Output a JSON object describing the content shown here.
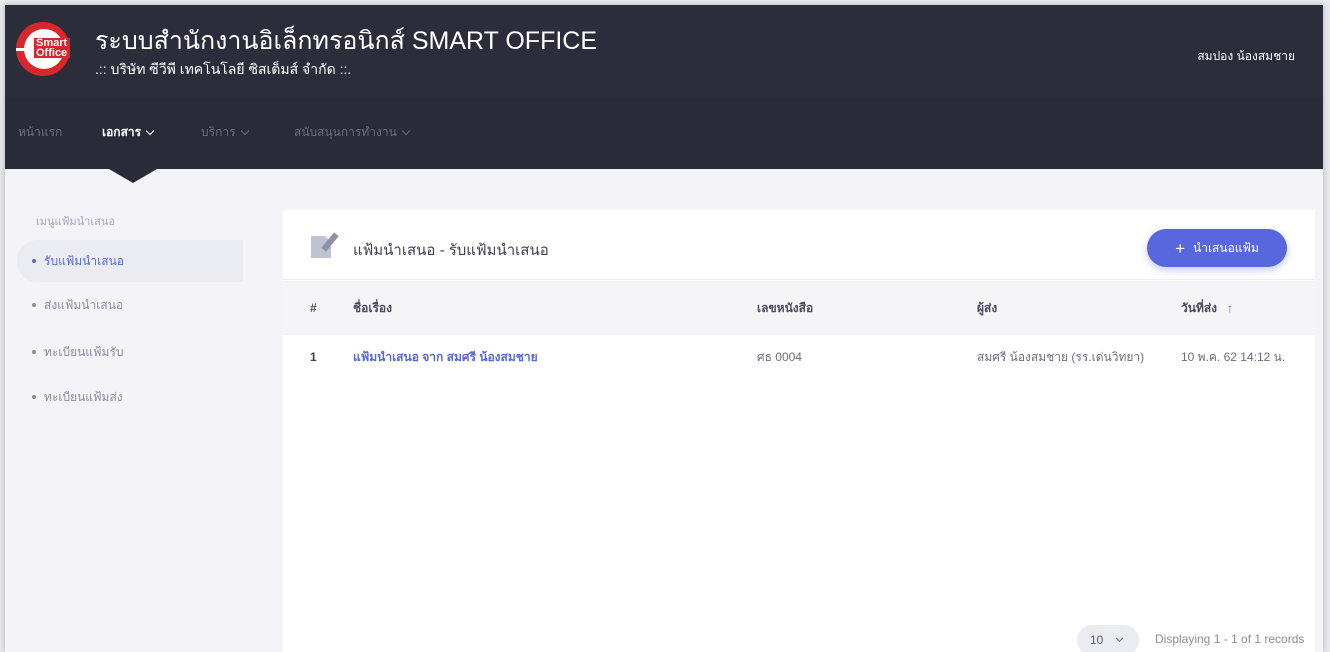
{
  "header": {
    "logo_text_1": "Smart",
    "logo_text_2": "Office",
    "title": "ระบบสำนักงานอิเล็กทรอนิกส์ SMART OFFICE",
    "subtitle": ".:: บริษัท ซีวีพี เทคโนโลยี ซิสเต็มส์ จำกัด ::.",
    "user_name": "สมปอง น้องสมชาย"
  },
  "nav": {
    "items": [
      {
        "label": "หน้าแรก",
        "active": false,
        "has_dropdown": false
      },
      {
        "label": "เอกสาร",
        "active": true,
        "has_dropdown": true
      },
      {
        "label": "บริการ",
        "active": false,
        "has_dropdown": true
      },
      {
        "label": "สนับสนุนการทำงาน",
        "active": false,
        "has_dropdown": true
      }
    ]
  },
  "sidebar": {
    "heading": "เมนูแฟ้มนำเสนอ",
    "items": [
      {
        "label": "รับแฟ้มนำเสนอ",
        "active": true
      },
      {
        "label": "ส่งแฟ้มนำเสนอ",
        "active": false
      },
      {
        "label": "ทะเบียนแฟ้มรับ",
        "active": false
      },
      {
        "label": "ทะเบียนแฟ้มส่ง",
        "active": false
      }
    ]
  },
  "card": {
    "title": "แฟ้มนำเสนอ - รับแฟ้มนำเสนอ",
    "add_button_label": "นำเสนอแฟ้ม",
    "add_button_icon": "+"
  },
  "table": {
    "columns": [
      "#",
      "ชื่อเรื่อง",
      "เลขหนังสือ",
      "ผู้ส่ง",
      "วันที่ส่ง"
    ],
    "sort_icon": "↑",
    "rows": [
      {
        "num": "1",
        "subject": "แฟ้มนำเสนอ จาก สมศรี น้องสมชาย",
        "doc_no": "ศธ 0004",
        "sender": "สมศรี น้องสมชาย (รร.เด่นวิทยา)",
        "date": "10 พ.ค. 62 14:12 น."
      }
    ]
  },
  "pager": {
    "page_size": "10",
    "info": "Displaying 1 - 1 of 1 records"
  },
  "colors": {
    "header_bg": "#2c2d3a",
    "accent": "#5867dd",
    "logo_red": "#d9262c"
  }
}
